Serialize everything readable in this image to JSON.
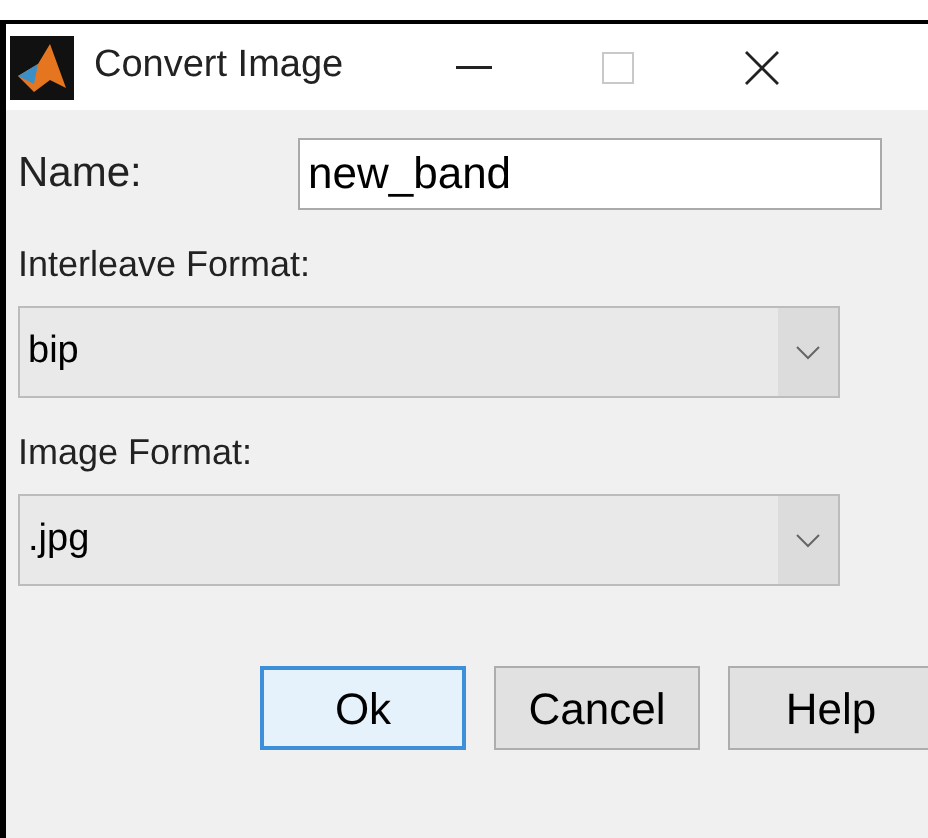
{
  "window": {
    "title": "Convert Image",
    "controls": [
      {
        "kind": "minimize"
      },
      {
        "kind": "maximize",
        "disabled": true
      },
      {
        "kind": "close"
      }
    ]
  },
  "name_field": {
    "label": "Name:",
    "value": "new_band"
  },
  "dropdowns": [
    {
      "label": "Interleave Format:",
      "value": "bip"
    },
    {
      "label": "Image Format:",
      "value": ".jpg"
    }
  ],
  "buttons": [
    {
      "label": "Ok",
      "focused": true
    },
    {
      "label": "Cancel",
      "focused": false
    },
    {
      "label": "Help",
      "focused": false
    }
  ]
}
